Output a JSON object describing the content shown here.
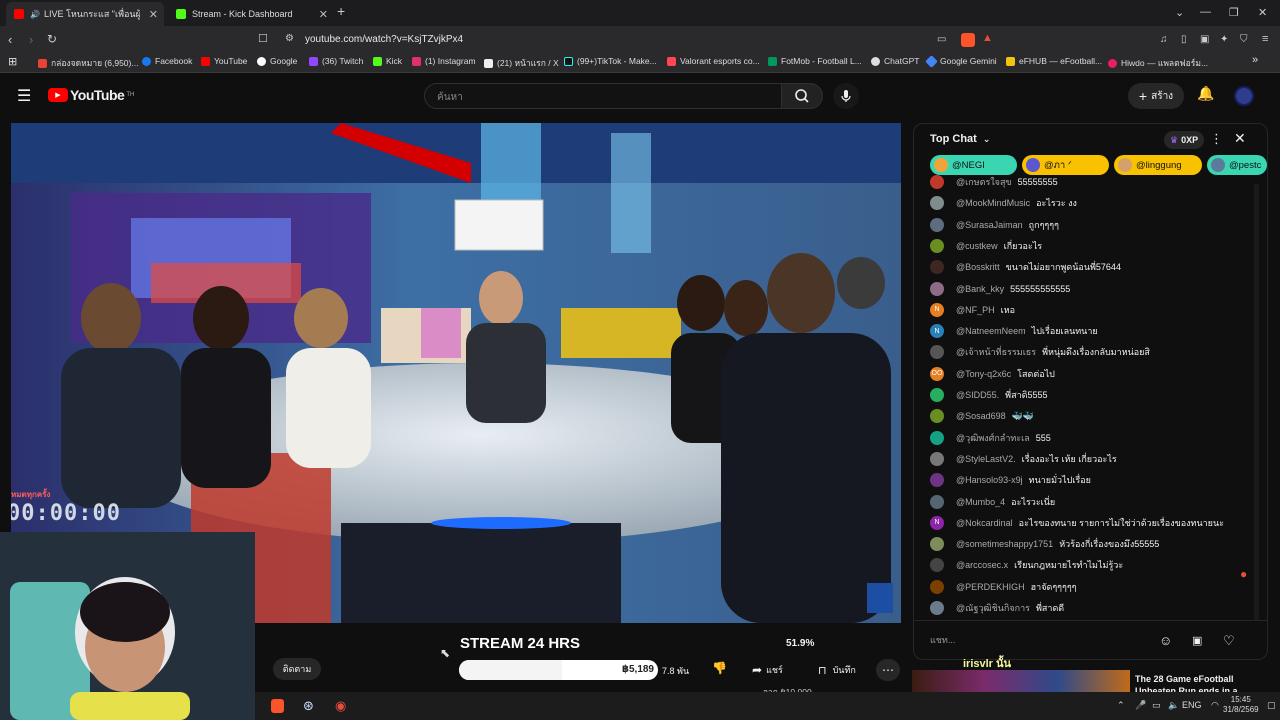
{
  "browser": {
    "tabs": [
      {
        "label": "LIVE โหนกระแส \"เพื่อนผู้หักล้",
        "active": true
      },
      {
        "label": "Stream - Kick Dashboard",
        "active": false
      }
    ],
    "url": "youtube.com/watch?v=KsjTZvjkPx4",
    "bookmarks": [
      "กล่องจดหมาย (6,950)...",
      "Facebook",
      "YouTube",
      "Google",
      "(36) Twitch",
      "Kick",
      "(1) Instagram",
      "(21) หน้าแรก / X",
      "(99+)TikTok - Make...",
      "Valorant esports co...",
      "FotMob - Football L...",
      "ChatGPT",
      "Google Gemini",
      "eFHUB — eFootball...",
      "Hiwdo — แพลตฟอร์ม..."
    ]
  },
  "youtube": {
    "logo": "YouTube",
    "logo_sup": "TH",
    "search_placeholder": "ค้นหา",
    "create_label": "สร้าง"
  },
  "video": {
    "title": "STREAM 24 HRS",
    "percent": "51.9%",
    "timer": "00:00:00",
    "like_count": "7.8 พัน",
    "share_label": "แชร์",
    "save_label": "บันทึก",
    "follow_label": "ติดตาม",
    "donation_amount": "฿5,189",
    "goal_label": "จาก ฿10,000",
    "overlay_caption": "หมดทุกครั้ง",
    "progress": 0.519
  },
  "chat": {
    "header": "Top Chat",
    "xp": "0XP",
    "chips": [
      "@NEGI",
      "@ภา ᐟ",
      "@linggung",
      "@pestc"
    ],
    "messages": [
      {
        "author": "@เกษตรใจสุข",
        "text": "55555555",
        "color": "#c0392b"
      },
      {
        "author": "@MookMindMusic",
        "text": "อะไรวะ งง",
        "color": "#7f8c8d"
      },
      {
        "author": "@SurasaJaiman",
        "text": "ถูกๆๆๆๆ",
        "color": "#5d6d7e"
      },
      {
        "author": "@custkew",
        "text": "เกี่ยวอะไร",
        "color": "#6b8e23"
      },
      {
        "author": "@Bosskritt",
        "text": "ขนาดไม่อยากพูดน้อนพี่57644",
        "color": "#3e2723"
      },
      {
        "author": "@Bank_kky",
        "text": "555555555555",
        "color": "#8e6c88"
      },
      {
        "author": "@NF_PH",
        "text": "เหอ",
        "color": "#e67e22",
        "letter": "N"
      },
      {
        "author": "@NatneemNeem",
        "text": "ไปเรื่อยเลนทนาย",
        "color": "#2980b9",
        "letter": "N"
      },
      {
        "author": "@เจ้าหน้าที่ธรรมเธร",
        "text": "พี่หนุ่มดึงเรื่องกลับมาหน่อยสิ",
        "color": "#555"
      },
      {
        "author": "@Tony-q2x6c",
        "text": "โสดต่อไป",
        "color": "#e67e22",
        "letter": "OO"
      },
      {
        "author": "@SIDD55.",
        "text": "พี่สาดิ5555",
        "color": "#27ae60"
      },
      {
        "author": "@Sosad698",
        "text": "🐳🐳",
        "color": "#6b8e23"
      },
      {
        "author": "@วุฒิพงศ์กลำทะเล",
        "text": "555",
        "color": "#16a085"
      },
      {
        "author": "@StyleLastV2.",
        "text": "เรื่องอะไร เห้ย เกี่ยวอะไร",
        "color": "#777"
      },
      {
        "author": "@Hansolo93-x9j",
        "text": "ทนายมั่วไปเรื่อย",
        "color": "#6c3483"
      },
      {
        "author": "@Mumbo_4",
        "text": "อะไรวะเนี่ย",
        "color": "#566573"
      },
      {
        "author": "@Nokcardinal",
        "text": "อะไรของทนาย รายการไม่ใช่ว่าด้วยเรื่องของทนายนะ",
        "color": "#8e24aa",
        "letter": "N"
      },
      {
        "author": "@sometimeshappy1751",
        "text": "หัวร้องกี่เรื่องของมึง55555",
        "color": "#7d8c5a"
      },
      {
        "author": "@arccosec.x",
        "text": "เรียนกฎหมายไรทำไมไม่รู้วะ",
        "color": "#444"
      },
      {
        "author": "@PERDEKHIGH",
        "text": "ฮาจัดๆๆๆๆๆ",
        "color": "#7b3f00"
      },
      {
        "author": "@ณัฐวุฒิชินกิจการ",
        "text": "พี่สาดดี",
        "color": "#6b7b8c"
      }
    ],
    "input_placeholder": "แชท..."
  },
  "below_chat": {
    "label": "irisvlr นั้น",
    "card_title": "The 28 Game eFootball Unbeaten Run ends in a"
  },
  "taskbar": {
    "lang": "ENG",
    "time": "15:45",
    "date": "31/8/2569"
  }
}
